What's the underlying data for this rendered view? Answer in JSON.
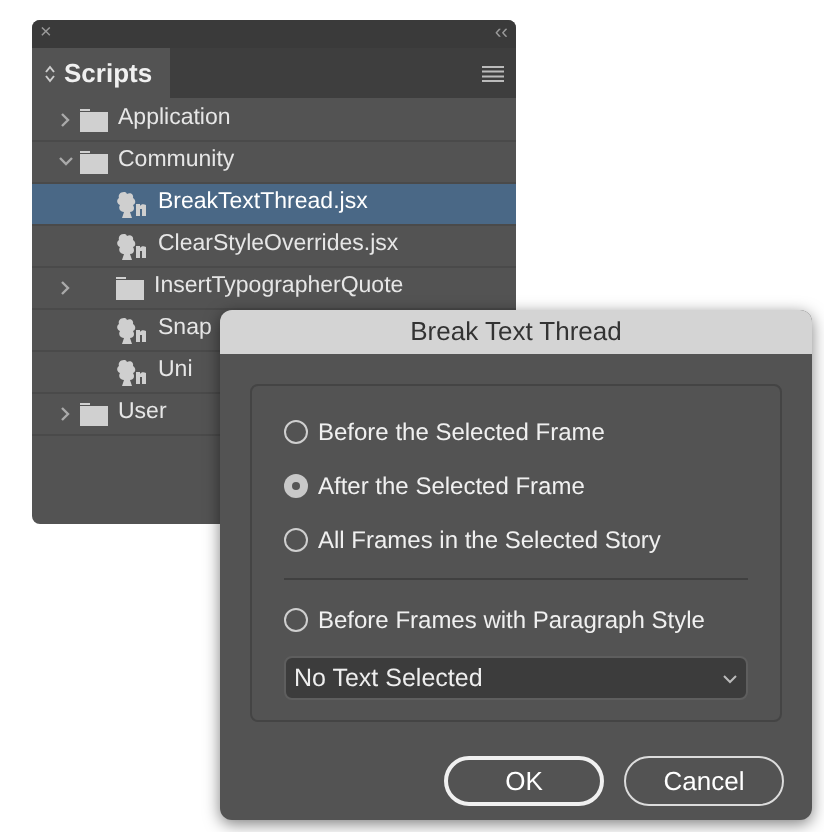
{
  "scripts_panel": {
    "close": "×",
    "collapse": "‹‹",
    "tab": {
      "label": "Scripts"
    },
    "tree": [
      {
        "kind": "folder",
        "label": "Application",
        "expanded": false,
        "selected": false
      },
      {
        "kind": "folder",
        "label": "Community",
        "expanded": true,
        "selected": false,
        "children": [
          {
            "kind": "script",
            "label": "BreakTextThread.jsx",
            "selected": true
          },
          {
            "kind": "script",
            "label": "ClearStyleOverrides.jsx",
            "selected": false
          },
          {
            "kind": "folder",
            "label": "InsertTypographerQuote",
            "expanded": false,
            "selected": false
          },
          {
            "kind": "script",
            "label": "Snap",
            "selected": false
          },
          {
            "kind": "script",
            "label": "Uni",
            "selected": false
          }
        ]
      },
      {
        "kind": "folder",
        "label": "User",
        "expanded": false,
        "selected": false
      }
    ]
  },
  "dialog": {
    "title": "Break Text Thread",
    "option_groups": [
      [
        {
          "label": "Before the Selected Frame",
          "selected": false
        },
        {
          "label": "After the Selected Frame",
          "selected": true
        },
        {
          "label": "All Frames in the Selected Story",
          "selected": false
        }
      ],
      [
        {
          "label": "Before Frames with Paragraph Style",
          "selected": false
        }
      ]
    ],
    "dropdown": {
      "value": "No Text Selected"
    },
    "buttons": [
      {
        "label": "OK",
        "default": true
      },
      {
        "label": "Cancel",
        "default": false
      }
    ]
  }
}
